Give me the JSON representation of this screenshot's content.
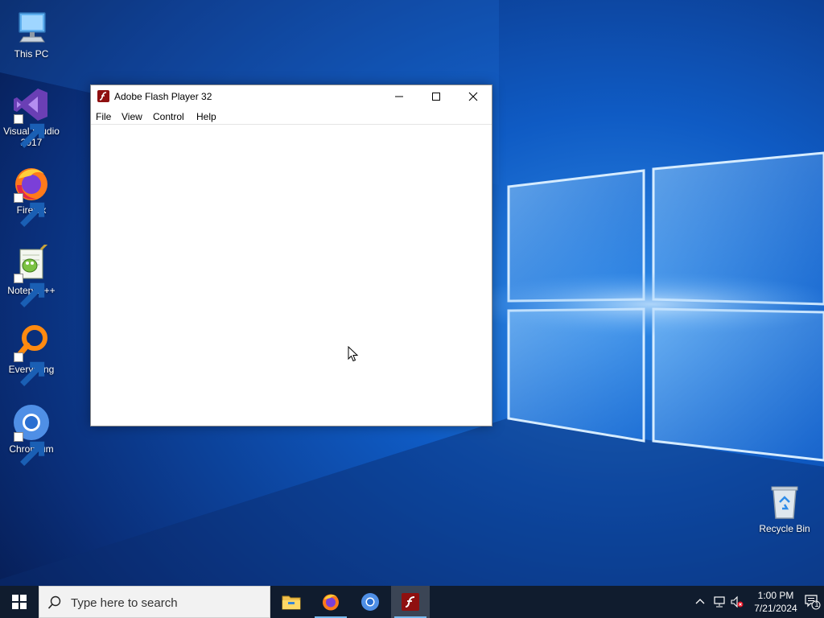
{
  "desktop": {
    "icons": [
      {
        "label": "This PC",
        "icon": "computer-icon"
      },
      {
        "label": "Visual Studio 2017",
        "icon": "visual-studio-icon"
      },
      {
        "label": "Firefox",
        "icon": "firefox-icon"
      },
      {
        "label": "Notepad++",
        "icon": "notepad-plus-plus-icon"
      },
      {
        "label": "Everything",
        "icon": "everything-search-icon"
      },
      {
        "label": "Chromium",
        "icon": "chromium-icon"
      },
      {
        "label": "Recycle Bin",
        "icon": "recycle-bin-icon"
      }
    ]
  },
  "window": {
    "title": "Adobe Flash Player 32",
    "menu": [
      "File",
      "View",
      "Control",
      "Help"
    ]
  },
  "taskbar": {
    "search_placeholder": "Type here to search",
    "apps": [
      "file-explorer-icon",
      "firefox-icon",
      "chromium-icon",
      "flash-player-icon"
    ],
    "active_app": "flash-player-icon"
  },
  "tray": {
    "time": "1:00 PM",
    "date": "7/21/2024",
    "notification_count": "1"
  },
  "colors": {
    "taskbar": "#101c2e",
    "accent": "#76b9ed",
    "flash_red": "#8f1010"
  }
}
